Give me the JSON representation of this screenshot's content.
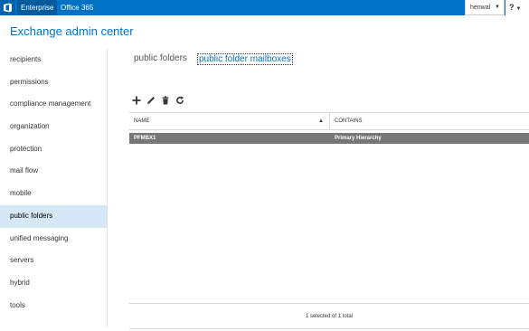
{
  "topbar": {
    "tabs": [
      {
        "label": "Enterprise",
        "active": true
      },
      {
        "label": "Office 365",
        "active": false
      }
    ],
    "user": "henwal",
    "help": "?"
  },
  "app_title": "Exchange admin center",
  "nav": {
    "items": [
      {
        "label": "recipients"
      },
      {
        "label": "permissions"
      },
      {
        "label": "compliance management"
      },
      {
        "label": "organization"
      },
      {
        "label": "protection"
      },
      {
        "label": "mail flow"
      },
      {
        "label": "mobile"
      },
      {
        "label": "public folders",
        "selected": true
      },
      {
        "label": "unified messaging"
      },
      {
        "label": "servers"
      },
      {
        "label": "hybrid"
      },
      {
        "label": "tools"
      }
    ]
  },
  "subtabs": [
    {
      "label": "public folders",
      "active": false
    },
    {
      "label": "public folder mailboxes",
      "active": true
    }
  ],
  "toolbar": {
    "buttons": [
      "add-icon",
      "edit-icon",
      "delete-icon",
      "refresh-icon"
    ]
  },
  "grid": {
    "columns": [
      "NAME",
      "CONTAINS"
    ],
    "rows": [
      {
        "name": "PFMBX1",
        "contains": "Primary Hierarchy",
        "selected": true
      }
    ],
    "footer": "1 selected of 1 total"
  },
  "colors": {
    "accent": "#0072c6",
    "selected_row": "#767676",
    "nav_selected": "#d5e8f6"
  }
}
